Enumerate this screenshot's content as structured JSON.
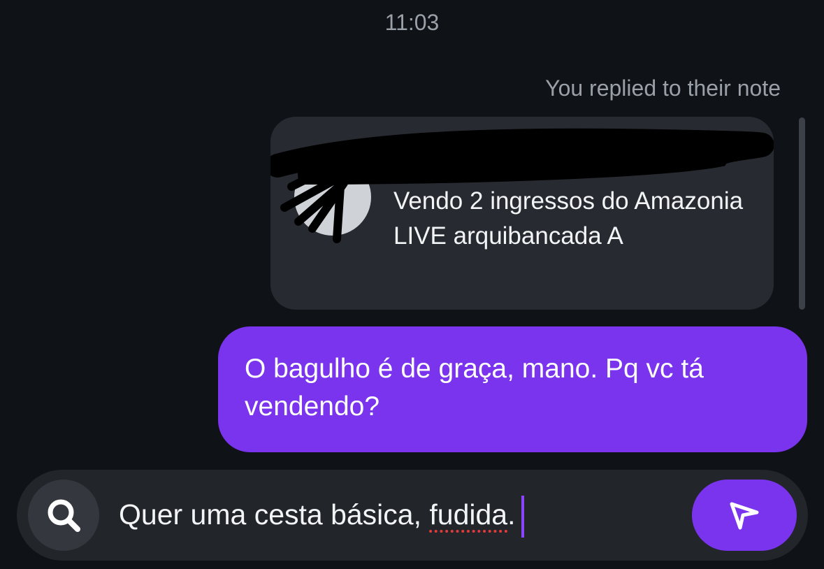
{
  "header": {
    "timestamp": "11:03"
  },
  "thread": {
    "reply_context": "You replied to their note",
    "note": {
      "text": "Vendo 2 ingressos do Amazonia LIVE arquibancada A"
    },
    "messages": [
      {
        "sender": "me",
        "text": "O bagulho é de graça, mano. Pq vc tá vendendo?"
      }
    ]
  },
  "composer": {
    "text_before": "Quer uma cesta básica, ",
    "misspelled_word": "fudida",
    "text_after": ".",
    "search_icon": "search-icon",
    "send_icon": "send-icon"
  },
  "colors": {
    "background": "#0f1216",
    "note_bg": "#272a30",
    "bubble": "#7b34ee",
    "caret": "#8b45ff"
  }
}
